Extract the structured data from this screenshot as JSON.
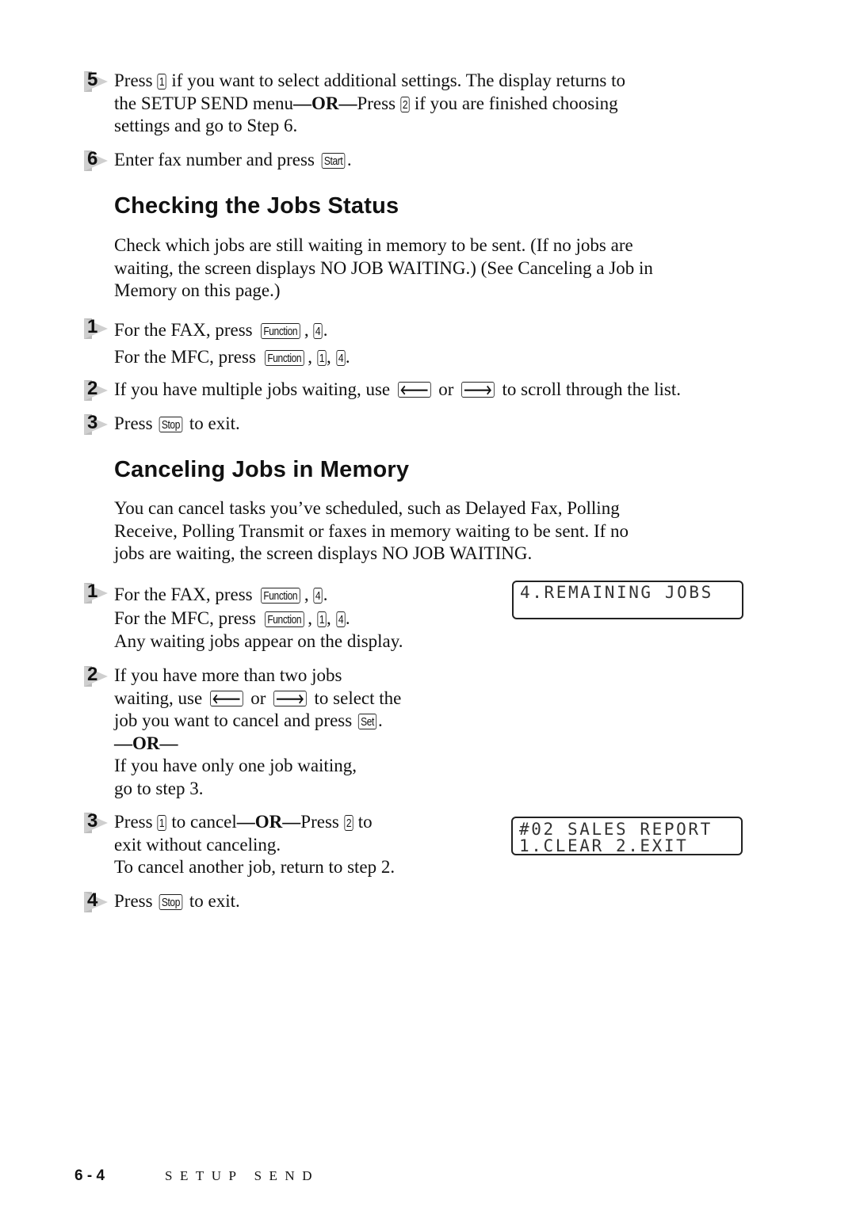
{
  "top_steps": [
    {
      "number": "5",
      "line1": {
        "a": "Press ",
        "key": "1",
        "b": " if you want to select additional settings. The display returns to"
      },
      "line2": {
        "a": "the SETUP SEND menu",
        "or": "—OR—",
        "b": "Press ",
        "key": "2",
        "c": " if you are finished choosing"
      },
      "line3": "settings and go to Step 6."
    },
    {
      "number": "6",
      "line1": {
        "a": "Enter fax number and press ",
        "key": "Start",
        "b": "."
      }
    }
  ],
  "section_checking": {
    "title": "Checking the Jobs Status",
    "intro": [
      "Check which jobs are still waiting in memory to be sent. (If no jobs are",
      "waiting, the screen displays NO JOB WAITING.) (See Canceling a Job in",
      "Memory on this page.)"
    ],
    "steps": [
      {
        "number": "1",
        "fax": {
          "a": "For the FAX, press ",
          "key1": "Function",
          "sep": ", ",
          "key2": "4",
          "end": "."
        },
        "mfc": {
          "a": "For the MFC, press ",
          "key1": "Function",
          "sep1": ", ",
          "key2": "1",
          "sep2": ", ",
          "key3": "4",
          "end": "."
        }
      },
      {
        "number": "2",
        "text": {
          "a": "If you have multiple jobs waiting, use ",
          "left_key": "🡐",
          "or": " or ",
          "right_key": "🡒",
          "b": " to scroll through the list."
        }
      },
      {
        "number": "3",
        "text": {
          "a": "Press ",
          "key": "Stop",
          "b": " to exit."
        }
      }
    ]
  },
  "section_canceling": {
    "title": "Canceling Jobs in Memory",
    "intro": [
      "You can cancel tasks you’ve scheduled, such as Delayed Fax, Polling",
      "Receive, Polling Transmit or faxes in memory waiting to be sent. If no",
      "jobs are waiting, the screen displays NO JOB WAITING."
    ],
    "steps": [
      {
        "number": "1",
        "fax": {
          "a": "For the FAX, press ",
          "key1": "Function",
          "sep": ", ",
          "key2": "4",
          "end": "."
        },
        "mfc": {
          "a": "For the MFC, press ",
          "key1": "Function",
          "sep1": ", ",
          "key2": "1",
          "sep2": ", ",
          "key3": "4",
          "end": "."
        },
        "note": "Any waiting jobs appear on the display.",
        "lcd": {
          "line1": "4.REMAINING JOBS",
          "line2": ""
        }
      },
      {
        "number": "2",
        "line1": "If you have more than two jobs",
        "line2": {
          "a": "waiting, use ",
          "left_key": "🡐",
          "or": " or ",
          "right_key": "🡒",
          "b": " to select the"
        },
        "line3": {
          "a": "job you want to cancel and press ",
          "key": "Set",
          "b": "."
        },
        "or": "—OR—",
        "line5": "If you have only one job waiting,",
        "line6": "go to step 3."
      },
      {
        "number": "3",
        "line1": {
          "a": "Press ",
          "key1": "1",
          "b": " to cancel",
          "or": "—OR—",
          "c": "Press ",
          "key2": "2",
          "d": " to"
        },
        "line2": "exit without canceling.",
        "line3": "To cancel another job, return to step 2.",
        "lcd": {
          "line1": "#02 SALES REPORT",
          "line2": "1.CLEAR 2.EXIT"
        }
      },
      {
        "number": "4",
        "text": {
          "a": "Press ",
          "key": "Stop",
          "b": " to exit."
        }
      }
    ]
  },
  "footer": {
    "page_number": "6 - 4",
    "chapter_title": "SETUP SEND"
  }
}
